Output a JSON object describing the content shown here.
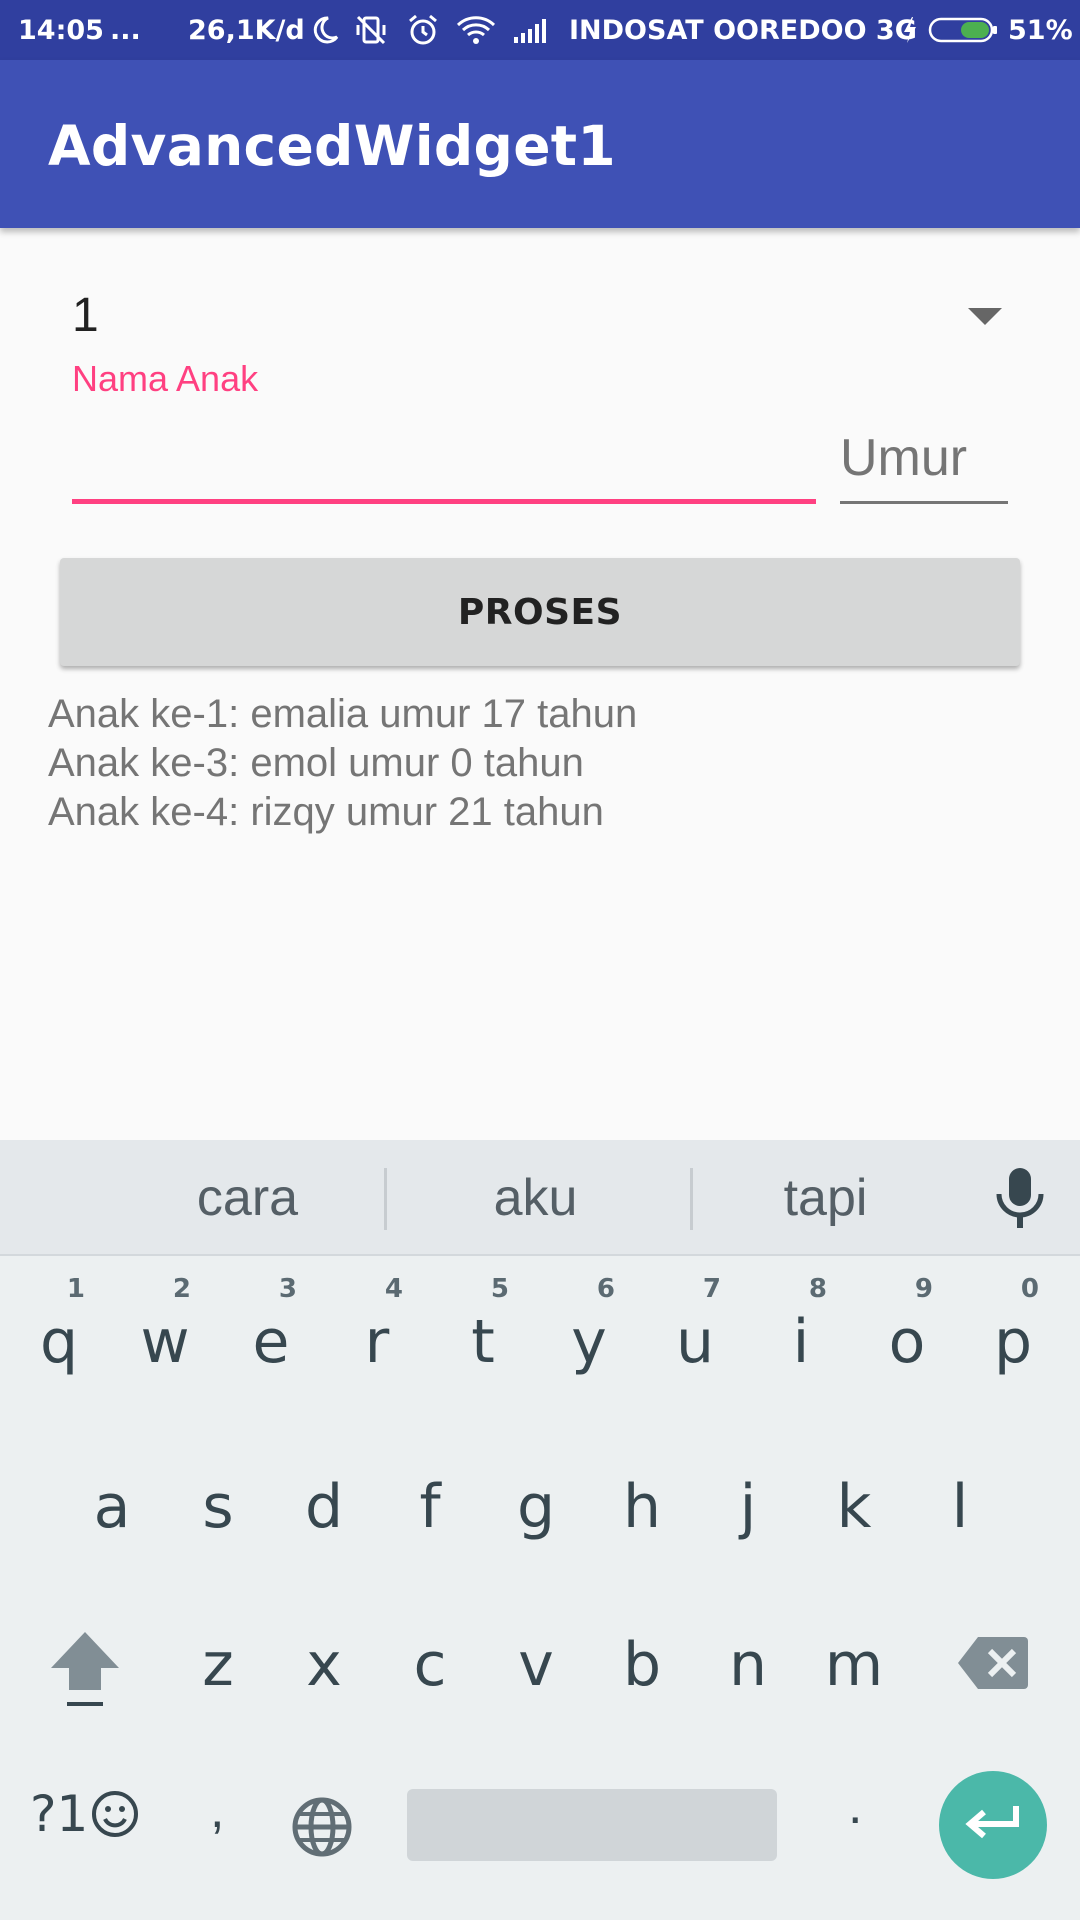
{
  "status_bar": {
    "time": "14:05",
    "dots": "...",
    "speed": "26,1K/d",
    "carrier": "INDOSAT OOREDOO 3G",
    "battery": "51%"
  },
  "app_bar": {
    "title": "AdvancedWidget1"
  },
  "form": {
    "spinner_value": "1",
    "name_label": "Nama Anak",
    "name_value": "",
    "age_placeholder": "Umur",
    "button_label": "PROSES"
  },
  "results": [
    "Anak ke-1: emalia umur 17 tahun",
    "Anak ke-3: emol umur 0 tahun",
    "Anak ke-4: rizqy umur 21 tahun"
  ],
  "keyboard": {
    "suggestions": [
      "cara",
      "aku",
      "tapi"
    ],
    "row1": [
      {
        "key": "q",
        "hint": "1"
      },
      {
        "key": "w",
        "hint": "2"
      },
      {
        "key": "e",
        "hint": "3"
      },
      {
        "key": "r",
        "hint": "4"
      },
      {
        "key": "t",
        "hint": "5"
      },
      {
        "key": "y",
        "hint": "6"
      },
      {
        "key": "u",
        "hint": "7"
      },
      {
        "key": "i",
        "hint": "8"
      },
      {
        "key": "o",
        "hint": "9"
      },
      {
        "key": "p",
        "hint": "0"
      }
    ],
    "row2": [
      "a",
      "s",
      "d",
      "f",
      "g",
      "h",
      "j",
      "k",
      "l"
    ],
    "row3": [
      "z",
      "x",
      "c",
      "v",
      "b",
      "n",
      "m"
    ],
    "symbols_label": "?1",
    "comma": ",",
    "period": "."
  },
  "colors": {
    "status_bar": "#303f9f",
    "app_bar": "#3f51b5",
    "accent": "#ff4081",
    "enter_key": "#4bb8a9",
    "keyboard_bg": "#ecf0f1"
  }
}
